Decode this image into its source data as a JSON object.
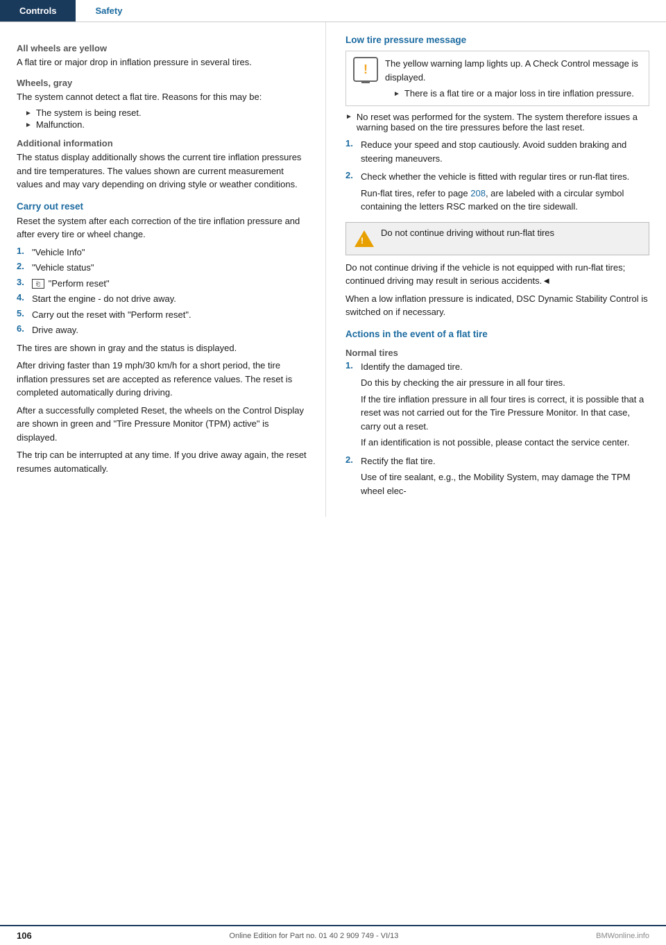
{
  "tabs": {
    "controls": "Controls",
    "safety": "Safety"
  },
  "left": {
    "section_all_wheels": {
      "heading": "All wheels are yellow",
      "body": "A flat tire or major drop in inflation pressure in several tires."
    },
    "section_wheels_gray": {
      "heading": "Wheels, gray",
      "body": "The system cannot detect a flat tire. Reasons for this may be:",
      "bullets": [
        "The system is being reset.",
        "Malfunction."
      ]
    },
    "section_additional": {
      "heading": "Additional information",
      "body": "The status display additionally shows the current tire inflation pressures and tire temperatures. The values shown are current measurement values and may vary depending on driving style or weather conditions."
    },
    "section_carry": {
      "heading": "Carry out reset",
      "intro": "Reset the system after each correction of the tire inflation pressure and after every tire or wheel change.",
      "steps": [
        {
          "num": "1.",
          "text": "\"Vehicle Info\""
        },
        {
          "num": "2.",
          "text": "\"Vehicle status\""
        },
        {
          "num": "3.",
          "text": "\"Perform reset\"",
          "icon": true
        },
        {
          "num": "4.",
          "text": "Start the engine - do not drive away."
        },
        {
          "num": "5.",
          "text": "Carry out the reset with \"Perform reset\"."
        },
        {
          "num": "6.",
          "text": "Drive away."
        }
      ],
      "after_steps_1": "The tires are shown in gray and the status is displayed.",
      "after_steps_2": "After driving faster than 19 mph/30 km/h for a short period, the tire inflation pressures set are accepted as reference values. The reset is completed automatically during driving.",
      "after_steps_3": "After a successfully completed Reset, the wheels on the Control Display are shown in green and \"Tire Pressure Monitor (TPM) active\" is displayed.",
      "after_steps_4": "The trip can be interrupted at any time. If you drive away again, the reset resumes automatically."
    }
  },
  "right": {
    "section_low_pressure": {
      "heading": "Low tire pressure message",
      "warning_text": "The yellow warning lamp lights up. A Check Control message is displayed.",
      "warning_bullet": "There is a flat tire or a major loss in tire inflation pressure.",
      "bullet2": "No reset was performed for the system. The system therefore issues a warning based on the tire pressures before the last reset.",
      "steps": [
        {
          "num": "1.",
          "parts": [
            "Reduce your speed and stop cautiously. Avoid sudden braking and steering maneuvers."
          ]
        },
        {
          "num": "2.",
          "parts": [
            "Check whether the vehicle is fitted with regular tires or run-flat tires.",
            "Run-flat tires, refer to page 208, are labeled with a circular symbol containing the letters RSC marked on the tire sidewall."
          ]
        }
      ],
      "caution_text": "Do not continue driving without run-flat tires",
      "caution_body": "Do not continue driving if the vehicle is not equipped with run-flat tires; continued driving may result in serious accidents.◄",
      "inflation_text": "When a low inflation pressure is indicated, DSC Dynamic Stability Control is switched on if necessary."
    },
    "section_actions": {
      "heading": "Actions in the event of a flat tire",
      "sub_normal": "Normal tires",
      "steps": [
        {
          "num": "1.",
          "parts": [
            "Identify the damaged tire.",
            "Do this by checking the air pressure in all four tires.",
            "If the tire inflation pressure in all four tires is correct, it is possible that a reset was not carried out for the Tire Pressure Monitor. In that case, carry out a reset.",
            "If an identification is not possible, please contact the service center."
          ]
        },
        {
          "num": "2.",
          "parts": [
            "Rectify the flat tire.",
            "Use of tire sealant, e.g., the Mobility System, may damage the TPM wheel elec-"
          ]
        }
      ]
    }
  },
  "footer": {
    "page_num": "106",
    "part_info": "Online Edition for Part no. 01 40 2 909 749 - VI/13",
    "logo": "BMWonline.info"
  }
}
